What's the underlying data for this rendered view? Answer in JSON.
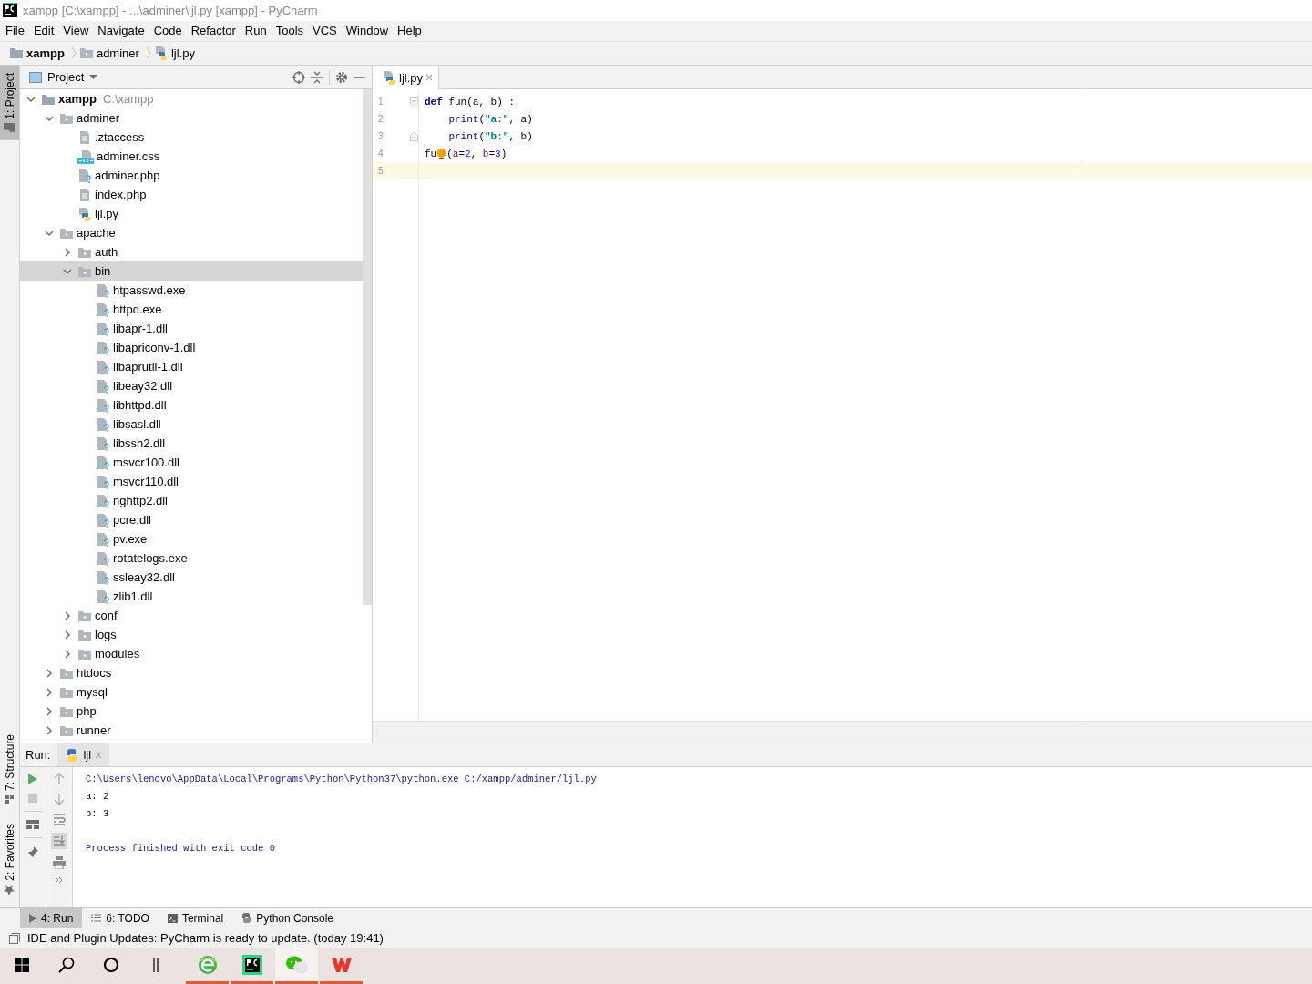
{
  "window": {
    "title": "xampp [C:\\xampp] - ...\\adminer\\ljl.py [xampp] - PyCharm"
  },
  "menu": [
    "File",
    "Edit",
    "View",
    "Navigate",
    "Code",
    "Refactor",
    "Run",
    "Tools",
    "VCS",
    "Window",
    "Help"
  ],
  "breadcrumb": [
    {
      "label": "xampp",
      "kind": "module"
    },
    {
      "label": "adminer",
      "kind": "folder"
    },
    {
      "label": "ljl.py",
      "kind": "python"
    }
  ],
  "side_tabs": {
    "top": [
      {
        "label": "1: Project",
        "selected": true
      }
    ],
    "bottom": [
      {
        "label": "7: Structure",
        "selected": false
      },
      {
        "label": "2: Favorites",
        "selected": false
      }
    ]
  },
  "project": {
    "title": "Project",
    "tree": [
      {
        "label": "xampp",
        "hint": "C:\\xampp",
        "kind": "module",
        "expanded": true,
        "selected": false,
        "children": [
          {
            "label": "adminer",
            "kind": "folder",
            "expanded": true,
            "selected": false,
            "children": [
              {
                "label": ".ztaccess",
                "kind": "text",
                "selected": false
              },
              {
                "label": "adminer.css",
                "kind": "css",
                "selected": false
              },
              {
                "label": "adminer.php",
                "kind": "unknown",
                "selected": false
              },
              {
                "label": "index.php",
                "kind": "text",
                "selected": false
              },
              {
                "label": "ljl.py",
                "kind": "python",
                "selected": false
              }
            ]
          },
          {
            "label": "apache",
            "kind": "folder",
            "expanded": true,
            "selected": false,
            "children": [
              {
                "label": "auth",
                "kind": "folder",
                "expanded": false,
                "selected": false
              },
              {
                "label": "bin",
                "kind": "folder",
                "expanded": true,
                "selected": true,
                "children": [
                  {
                    "label": "htpasswd.exe",
                    "kind": "unknown",
                    "selected": false
                  },
                  {
                    "label": "httpd.exe",
                    "kind": "unknown",
                    "selected": false
                  },
                  {
                    "label": "libapr-1.dll",
                    "kind": "unknown",
                    "selected": false
                  },
                  {
                    "label": "libapriconv-1.dll",
                    "kind": "unknown",
                    "selected": false
                  },
                  {
                    "label": "libaprutil-1.dll",
                    "kind": "unknown",
                    "selected": false
                  },
                  {
                    "label": "libeay32.dll",
                    "kind": "unknown",
                    "selected": false
                  },
                  {
                    "label": "libhttpd.dll",
                    "kind": "unknown",
                    "selected": false
                  },
                  {
                    "label": "libsasl.dll",
                    "kind": "unknown",
                    "selected": false
                  },
                  {
                    "label": "libssh2.dll",
                    "kind": "unknown",
                    "selected": false
                  },
                  {
                    "label": "msvcr100.dll",
                    "kind": "unknown",
                    "selected": false
                  },
                  {
                    "label": "msvcr110.dll",
                    "kind": "unknown",
                    "selected": false
                  },
                  {
                    "label": "nghttp2.dll",
                    "kind": "unknown",
                    "selected": false
                  },
                  {
                    "label": "pcre.dll",
                    "kind": "unknown",
                    "selected": false
                  },
                  {
                    "label": "pv.exe",
                    "kind": "unknown",
                    "selected": false
                  },
                  {
                    "label": "rotatelogs.exe",
                    "kind": "unknown",
                    "selected": false
                  },
                  {
                    "label": "ssleay32.dll",
                    "kind": "unknown",
                    "selected": false
                  },
                  {
                    "label": "zlib1.dll",
                    "kind": "unknown",
                    "selected": false
                  }
                ]
              },
              {
                "label": "conf",
                "kind": "folder",
                "expanded": false,
                "selected": false
              },
              {
                "label": "logs",
                "kind": "folder",
                "expanded": false,
                "selected": false
              },
              {
                "label": "modules",
                "kind": "folder",
                "expanded": false,
                "selected": false
              }
            ]
          },
          {
            "label": "htdocs",
            "kind": "folder",
            "expanded": false,
            "selected": false
          },
          {
            "label": "mysql",
            "kind": "folder",
            "expanded": false,
            "selected": false
          },
          {
            "label": "php",
            "kind": "folder",
            "expanded": false,
            "selected": false
          },
          {
            "label": "runner",
            "kind": "folder",
            "expanded": false,
            "selected": false
          }
        ]
      }
    ]
  },
  "editor": {
    "tabs": [
      {
        "label": "ljl.py",
        "selected": true
      }
    ],
    "lines": [
      {
        "number": "1",
        "fold_start": true,
        "current": false,
        "tokens": [
          {
            "text": "def",
            "kind": "keyword"
          },
          {
            "text": " fun(a, b) :",
            "kind": "plain"
          }
        ]
      },
      {
        "number": "2",
        "current": false,
        "indented": true,
        "tokens": [
          {
            "text": "print",
            "kind": "builtin"
          },
          {
            "text": "(",
            "kind": "plain"
          },
          {
            "text": "\"a:\"",
            "kind": "string"
          },
          {
            "text": ", a)",
            "kind": "plain"
          }
        ]
      },
      {
        "number": "3",
        "fold_end": true,
        "current": false,
        "indented": true,
        "tokens": [
          {
            "text": "print",
            "kind": "builtin"
          },
          {
            "text": "(",
            "kind": "plain"
          },
          {
            "text": "\"b:\"",
            "kind": "string"
          },
          {
            "text": ", b)",
            "kind": "plain"
          }
        ]
      },
      {
        "number": "4",
        "current": false,
        "tokens": [
          {
            "text": "fu",
            "kind": "plain"
          },
          {
            "kind": "bulb"
          },
          {
            "text": "(",
            "kind": "plain"
          },
          {
            "text": "a",
            "kind": "param"
          },
          {
            "text": "=",
            "kind": "plain"
          },
          {
            "text": "2",
            "kind": "number"
          },
          {
            "text": ", ",
            "kind": "plain"
          },
          {
            "text": "b",
            "kind": "param"
          },
          {
            "text": "=",
            "kind": "plain"
          },
          {
            "text": "3",
            "kind": "number"
          },
          {
            "text": ")",
            "kind": "plain"
          }
        ]
      },
      {
        "number": "5",
        "current": true
      }
    ]
  },
  "run": {
    "label": "Run:",
    "tabs": [
      {
        "label": "ljl",
        "selected": true
      }
    ],
    "output": [
      {
        "text": "C:\\Users\\lenovo\\AppData\\Local\\Programs\\Python\\Python37\\python.exe C:/xampp/adminer/ljl.py",
        "kind": "command"
      },
      {
        "text": "a: 2",
        "kind": "stdout"
      },
      {
        "text": "b: 3",
        "kind": "stdout"
      },
      {
        "text": "Process finished with exit code 0",
        "kind": "exit"
      }
    ]
  },
  "tool_tabs": [
    {
      "label": "4: Run",
      "kind": "run",
      "selected": true
    },
    {
      "label": "6: TODO",
      "kind": "todo",
      "selected": false
    },
    {
      "label": "Terminal",
      "kind": "terminal",
      "selected": false
    },
    {
      "label": "Python Console",
      "kind": "console",
      "selected": false
    }
  ],
  "status_bar": {
    "message": "IDE and Plugin Updates: PyCharm is ready to update. (today 19:41)"
  },
  "taskbar": [
    {
      "kind": "start",
      "running": false,
      "selected": false
    },
    {
      "kind": "search",
      "running": false,
      "selected": false
    },
    {
      "kind": "cortana",
      "running": false,
      "selected": false
    },
    {
      "kind": "taskview",
      "running": false,
      "selected": false
    },
    {
      "kind": "browser",
      "running": true,
      "selected": false
    },
    {
      "kind": "pycharm",
      "running": true,
      "selected": false
    },
    {
      "kind": "chat",
      "running": true,
      "selected": true
    },
    {
      "kind": "office",
      "running": true,
      "selected": false
    }
  ]
}
